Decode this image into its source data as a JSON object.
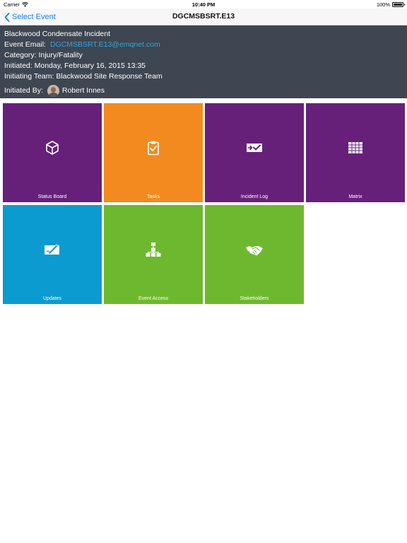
{
  "status_bar": {
    "carrier": "Carrier",
    "time": "10:40 PM",
    "battery": "100%"
  },
  "nav": {
    "back_label": "Select Event",
    "title": "DGCMSBSRT.E13"
  },
  "event": {
    "name": "Blackwood Condensate Incident",
    "email_label": "Event Email:",
    "email": "DGCMSBSRT.E13@emqnet.com",
    "category": "Category: Injury/Fatality",
    "initiated": "Initiated: Monday, February 16, 2015 13:35",
    "team": "Initiating Team: Blackwood Site Response Team",
    "initiated_by_label": "Initiated By:",
    "initiated_by": "Robert Innes"
  },
  "tiles": [
    {
      "label": "Status Board",
      "icon": "cube-icon",
      "color": "#66207a"
    },
    {
      "label": "Tasks",
      "icon": "clipboard-check-icon",
      "color": "#f38a1f"
    },
    {
      "label": "Incident Log",
      "icon": "log-check-icon",
      "color": "#66207a"
    },
    {
      "label": "Matrix",
      "icon": "grid-table-icon",
      "color": "#66207a"
    },
    {
      "label": "Updates",
      "icon": "pen-note-icon",
      "color": "#0b9bd0"
    },
    {
      "label": "Event Access",
      "icon": "org-chart-icon",
      "color": "#6eb82f"
    },
    {
      "label": "Stakeholders",
      "icon": "handshake-icon",
      "color": "#6eb82f"
    }
  ]
}
